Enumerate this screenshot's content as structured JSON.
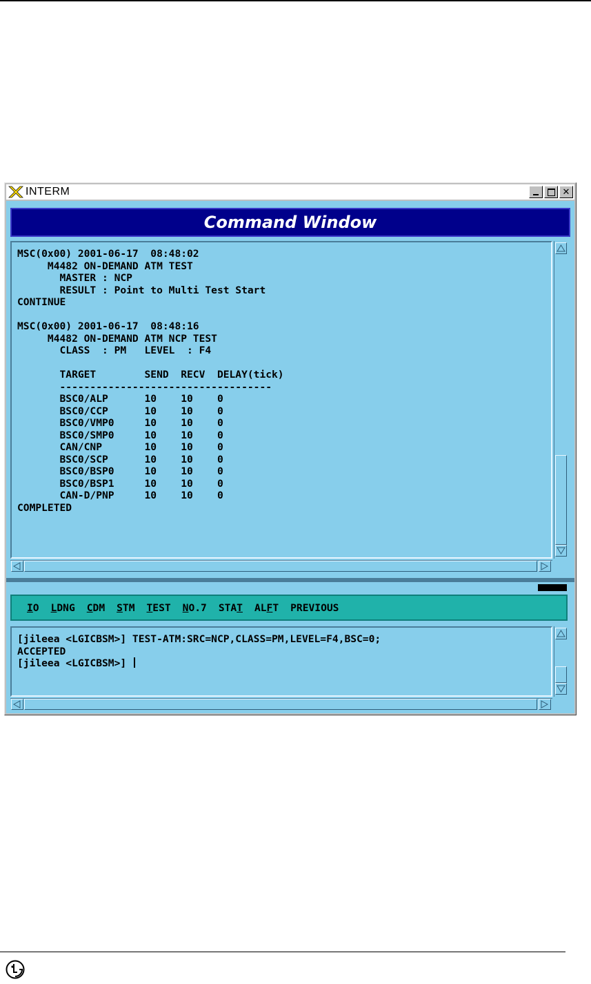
{
  "window": {
    "title": "INTERM",
    "header_title": "Command Window",
    "controls": [
      "minimize",
      "maximize",
      "close"
    ]
  },
  "output": {
    "lines": [
      "MSC(0x00) 2001-06-17  08:48:02",
      "     M4482 ON-DEMAND ATM TEST",
      "       MASTER : NCP",
      "       RESULT : Point to Multi Test Start",
      "CONTINUE",
      "",
      "MSC(0x00) 2001-06-17  08:48:16",
      "     M4482 ON-DEMAND ATM NCP TEST",
      "       CLASS  : PM   LEVEL  : F4",
      "",
      "       TARGET        SEND  RECV  DELAY(tick)",
      "       -----------------------------------",
      "       BSC0/ALP      10    10    0",
      "       BSC0/CCP      10    10    0",
      "       BSC0/VMP0     10    10    0",
      "       BSC0/SMP0     10    10    0",
      "       CAN/CNP       10    10    0",
      "       BSC0/SCP      10    10    0",
      "       BSC0/BSP0     10    10    0",
      "       BSC0/BSP1     10    10    0",
      "       CAN-D/PNP     10    10    0",
      "COMPLETED"
    ]
  },
  "menu": {
    "items": [
      {
        "pre": "",
        "u": "I",
        "post": "O"
      },
      {
        "pre": "",
        "u": "L",
        "post": "DNG"
      },
      {
        "pre": "",
        "u": "C",
        "post": "DM"
      },
      {
        "pre": "",
        "u": "S",
        "post": "TM"
      },
      {
        "pre": "",
        "u": "T",
        "post": "EST"
      },
      {
        "pre": "",
        "u": "N",
        "post": "O.7"
      },
      {
        "pre": "STA",
        "u": "T",
        "post": ""
      },
      {
        "pre": "AL",
        "u": "F",
        "post": "T"
      },
      {
        "pre": "PREVIOUS",
        "u": "",
        "post": ""
      }
    ]
  },
  "input": {
    "lines": [
      "[jileea <LGICBSM>] TEST-ATM:SRC=NCP,CLASS=PM,LEVEL=F4,BSC=0;",
      "ACCEPTED"
    ],
    "prompt": "[jileea <LGICBSM>] "
  },
  "colors": {
    "pane_bg": "#87ceeb",
    "header_bg": "#00008b",
    "menubar_bg": "#20b2aa"
  }
}
